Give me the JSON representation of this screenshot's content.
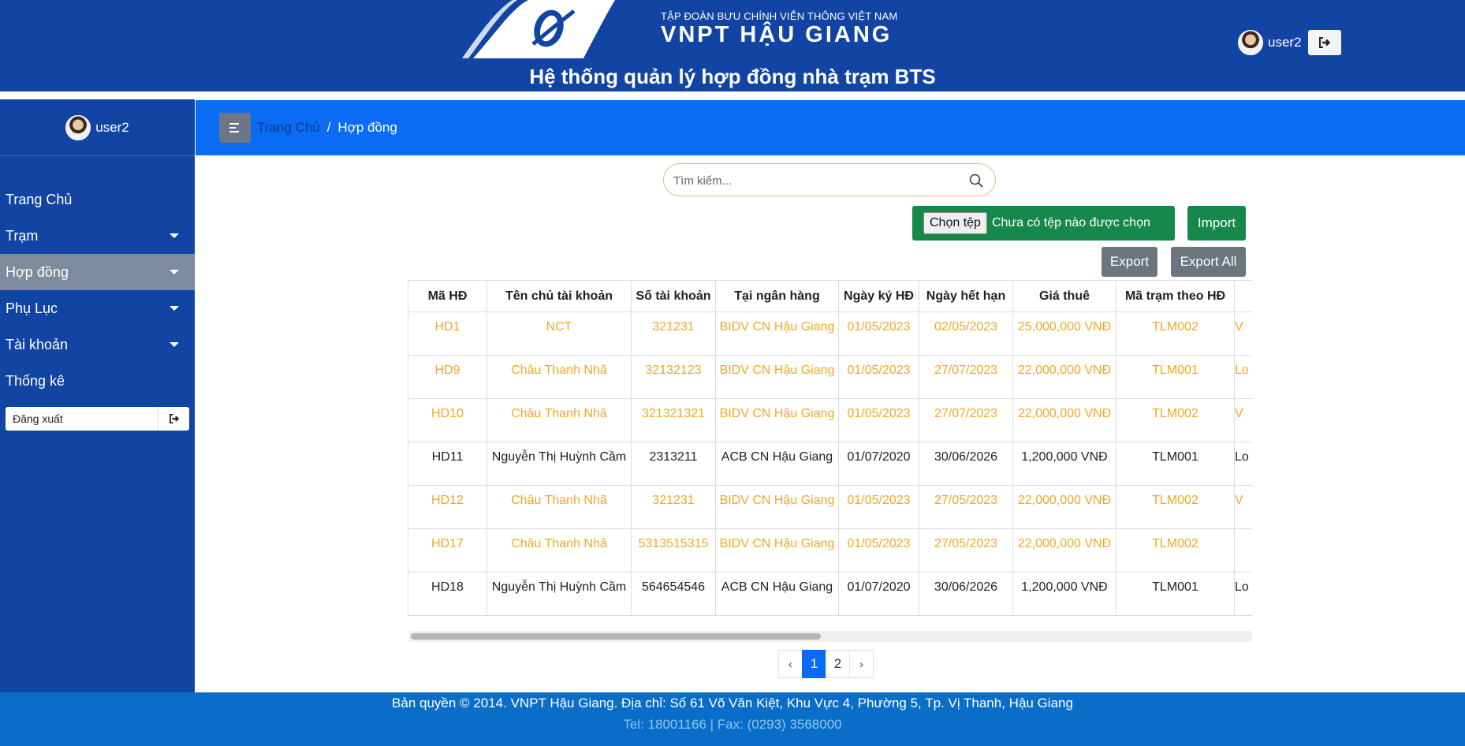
{
  "header": {
    "brand_small": "TẬP ĐOÀN BƯU CHÍNH VIỄN THÔNG VIỆT NAM",
    "brand_big": "VNPT HẬU GIANG",
    "system_title": "Hệ thống quản lý hợp đồng nhà trạm BTS",
    "username": "user2"
  },
  "sidebar": {
    "username": "user2",
    "items": [
      {
        "label": "Trang Chủ"
      },
      {
        "label": "Trạm"
      },
      {
        "label": "Hợp đồng"
      },
      {
        "label": "Phụ Lục"
      },
      {
        "label": "Tài khoản"
      },
      {
        "label": "Thống kê"
      }
    ],
    "active_item": "Hợp đồng",
    "logout_label": "Đăng xuất"
  },
  "breadcrumb": {
    "home": "Trang Chủ",
    "separator": "/",
    "current": "Hợp đồng"
  },
  "search": {
    "placeholder": "Tìm kiếm...",
    "value": ""
  },
  "file_input": {
    "button": "Chọn tệp",
    "status": "Chưa có tệp nào được chọn"
  },
  "actions": {
    "import": "Import",
    "export": "Export",
    "export_all": "Export All"
  },
  "table": {
    "columns": [
      "Mã HĐ",
      "Tên chủ tài khoản",
      "Số tài khoản",
      "Tại ngân hàng",
      "Ngày ký HĐ",
      "Ngày hết hạn",
      "Giá thuê",
      "Mã trạm theo HĐ",
      ""
    ],
    "rows": [
      {
        "highlight": true,
        "cells": [
          "HD1",
          "NCT",
          "321231",
          "BIDV CN Hậu Giang",
          "01/05/2023",
          "02/05/2023",
          "25,000,000 VNĐ",
          "TLM002",
          "V"
        ]
      },
      {
        "highlight": true,
        "cells": [
          "HD9",
          "Châu Thanh Nhã",
          "32132123",
          "BIDV CN Hậu Giang",
          "01/05/2023",
          "27/07/2023",
          "22,000,000 VNĐ",
          "TLM001",
          "Lo"
        ]
      },
      {
        "highlight": true,
        "cells": [
          "HD10",
          "Châu Thanh Nhã",
          "321321321",
          "BIDV CN Hậu Giang",
          "01/05/2023",
          "27/07/2023",
          "22,000,000 VNĐ",
          "TLM002",
          "V"
        ]
      },
      {
        "highlight": false,
        "cells": [
          "HD11",
          "Nguyễn Thị Huỳnh Cầm",
          "2313211",
          "ACB CN Hậu Giang",
          "01/07/2020",
          "30/06/2026",
          "1,200,000 VNĐ",
          "TLM001",
          "Lo"
        ]
      },
      {
        "highlight": true,
        "cells": [
          "HD12",
          "Châu Thanh Nhã",
          "321231",
          "BIDV CN Hậu Giang",
          "01/05/2023",
          "27/05/2023",
          "22,000,000 VNĐ",
          "TLM002",
          "V"
        ]
      },
      {
        "highlight": true,
        "cells": [
          "HD17",
          "Châu Thanh Nhã",
          "5313515315",
          "BIDV CN Hậu Giang",
          "01/05/2023",
          "27/05/2023",
          "22,000,000 VNĐ",
          "TLM002",
          ""
        ]
      },
      {
        "highlight": false,
        "cells": [
          "HD18",
          "Nguyễn Thị Huỳnh Cầm",
          "564654546",
          "ACB CN Hậu Giang",
          "01/07/2020",
          "30/06/2026",
          "1,200,000 VNĐ",
          "TLM001",
          "Lo"
        ]
      }
    ],
    "highlight_color": "#f5a623"
  },
  "pagination": {
    "prev": "‹",
    "pages": [
      "1",
      "2"
    ],
    "current": "1",
    "next": "›"
  },
  "footer": {
    "line1": "Bản quyền © 2014. VNPT Hậu Giang. Địa chỉ: Số 61 Võ Văn Kiệt, Khu Vực 4, Phường 5, Tp. Vị Thanh, Hậu Giang",
    "line2": "Tel: 18001166 | Fax: (0293) 3568000"
  },
  "colors": {
    "header": "#1244a4",
    "crumb_bar": "#0a6cf5",
    "footer": "#0a6ec9",
    "success": "#16894a",
    "secondary": "#6c757d"
  }
}
